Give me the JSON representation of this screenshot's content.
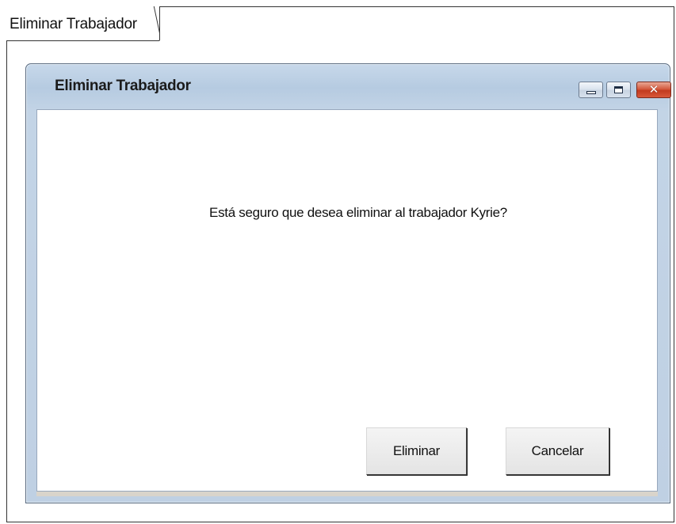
{
  "frame": {
    "label": "Eliminar Trabajador"
  },
  "window": {
    "title": "Eliminar Trabajador",
    "controls": {
      "minimize_icon": "minimize-icon",
      "maximize_icon": "maximize-icon",
      "close_icon": "close-icon",
      "close_glyph": "✕"
    }
  },
  "dialog": {
    "message": "Está seguro que desea eliminar al trabajador Kyrie?",
    "delete_label": "Eliminar",
    "cancel_label": "Cancelar"
  },
  "colors": {
    "title_bar": "#bfd0e3",
    "close_button": "#c23a1f"
  }
}
